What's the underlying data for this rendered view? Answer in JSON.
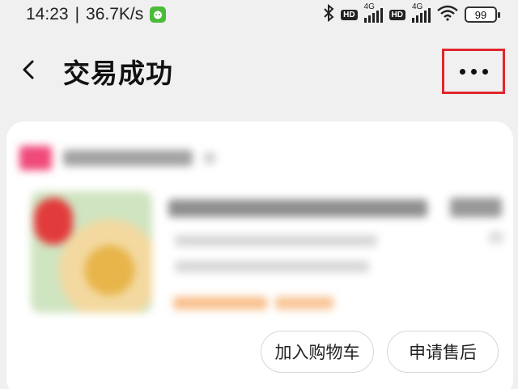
{
  "status_bar": {
    "time": "14:23",
    "separator": "|",
    "net_speed": "36.7K/s",
    "net_1": {
      "hd": "HD",
      "gen": "4G"
    },
    "net_2": {
      "hd": "HD",
      "gen": "4G"
    },
    "battery": "99"
  },
  "header": {
    "title": "交易成功"
  },
  "order": {
    "buttons": {
      "add_to_cart": "加入购物车",
      "after_sales": "申请售后"
    }
  },
  "colors": {
    "highlight_box": "#e0262d",
    "background": "#f0f0f0",
    "card": "#ffffff"
  }
}
